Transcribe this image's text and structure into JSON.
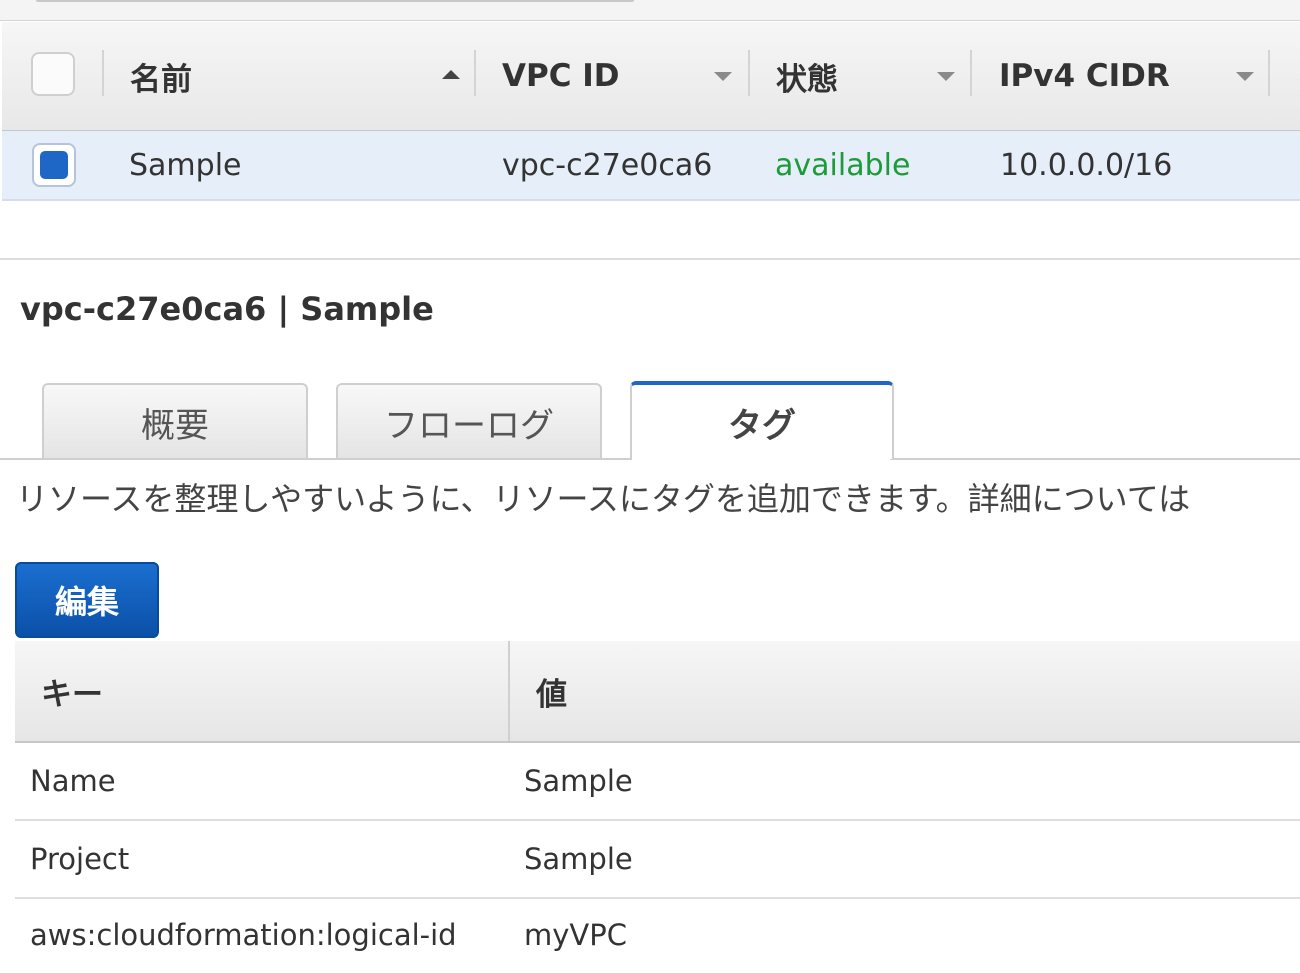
{
  "vpc_table": {
    "columns": [
      {
        "label": "名前",
        "sort": "ascending"
      },
      {
        "label": "VPC ID",
        "sort": "dropdown"
      },
      {
        "label": "状態",
        "sort": "dropdown"
      },
      {
        "label": "IPv4 CIDR",
        "sort": "dropdown"
      }
    ],
    "rows": [
      {
        "selected": true,
        "name": "Sample",
        "vpc_id": "vpc-c27e0ca6",
        "state": "available",
        "cidr": "10.0.0.0/16"
      }
    ]
  },
  "detail": {
    "title": "vpc-c27e0ca6 | Sample",
    "tabs": [
      {
        "label": "概要",
        "active": false
      },
      {
        "label": "フローログ",
        "active": false
      },
      {
        "label": "タグ",
        "active": true
      }
    ],
    "description": "リソースを整理しやすいように、リソースにタグを追加できます。詳細については",
    "edit_label": "編集"
  },
  "tag_table": {
    "columns": [
      "キー",
      "値"
    ],
    "rows": [
      {
        "key": "Name",
        "value": "Sample"
      },
      {
        "key": "Project",
        "value": "Sample"
      },
      {
        "key": "aws:cloudformation:logical-id",
        "value": "myVPC"
      }
    ]
  },
  "colors": {
    "accent": "#1f67c6",
    "status_available": "#1c9b3b",
    "selected_row": "#e6eef9"
  }
}
